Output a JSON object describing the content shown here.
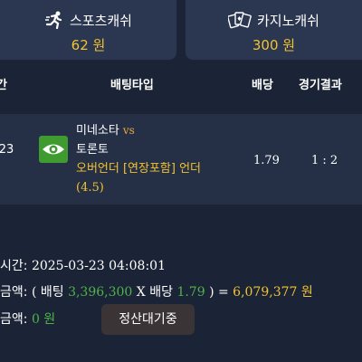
{
  "cash": {
    "sports": {
      "label": "스포츠캐쉬",
      "value": "62 원",
      "icon": "running-person-icon"
    },
    "casino": {
      "label": "카지노캐쉬",
      "value": "300 원",
      "icon": "playing-cards-icon"
    }
  },
  "table": {
    "headers": {
      "time": "간",
      "bet_type": "배팅타입",
      "odds": "배당",
      "result": "경기결과"
    }
  },
  "bet": {
    "time": "-23",
    "icon": "eye-icon",
    "home": "미네소타",
    "vs": "vs",
    "away": "토론토",
    "pick_type": "오버언더 [연장포함] 언더",
    "pick_line": "(4.5)",
    "odds": "1.79",
    "score": "1 : 2"
  },
  "summary": {
    "time_label": "시간:",
    "time_value": "2025-03-23 04:08:01",
    "amount_label": "금액:",
    "formula_open": "( 배팅",
    "stake": "3,396,300",
    "formula_x": "X 배당",
    "odds": "1.79",
    "formula_close": ") =",
    "payout": "6,079,377 원",
    "win_label": "금액:",
    "win_value": "0 원",
    "status": "정산대기중"
  },
  "colors": {
    "background": "#1b2436",
    "card": "#2b3650",
    "accent_yellow": "#f2c230",
    "accent_green": "#4fb34a"
  }
}
